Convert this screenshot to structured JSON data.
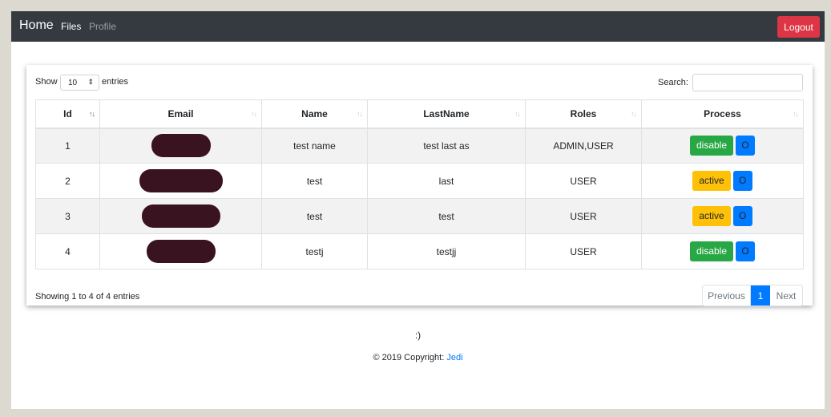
{
  "nav": {
    "brand": "Home",
    "files": "Files",
    "profile": "Profile",
    "logout": "Logout"
  },
  "table_controls": {
    "show": "Show",
    "page_length": "10",
    "entries": "entries",
    "search_label": "Search:",
    "search_value": ""
  },
  "columns": [
    "Id",
    "Email",
    "Name",
    "LastName",
    "Roles",
    "Process"
  ],
  "rows": [
    {
      "id": "1",
      "name": "test name",
      "lastname": "test last as",
      "roles": "ADMIN,USER",
      "status_button": "disable",
      "o_button": "O"
    },
    {
      "id": "2",
      "name": "test",
      "lastname": "last",
      "roles": "USER",
      "status_button": "active",
      "o_button": "O"
    },
    {
      "id": "3",
      "name": "test",
      "lastname": "test",
      "roles": "USER",
      "status_button": "active",
      "o_button": "O"
    },
    {
      "id": "4",
      "name": "testj",
      "lastname": "testjj",
      "roles": "USER",
      "status_button": "disable",
      "o_button": "O"
    }
  ],
  "footer_table": {
    "info": "Showing 1 to 4 of 4 entries",
    "previous": "Previous",
    "page": "1",
    "next": "Next"
  },
  "footer": {
    "smile": ":)",
    "copyright_prefix": "© 2019 Copyright:",
    "copyright_link": "Jedi"
  },
  "colors": {
    "navbar": "#343a40",
    "logout": "#dc3545",
    "disable_button": "#28a745",
    "active_button": "#ffc107",
    "o_button": "#007bff",
    "redaction": "#3a1320"
  },
  "icons": [
    "sort-asc-icon",
    "sort-icon",
    "select-caret-icon"
  ]
}
